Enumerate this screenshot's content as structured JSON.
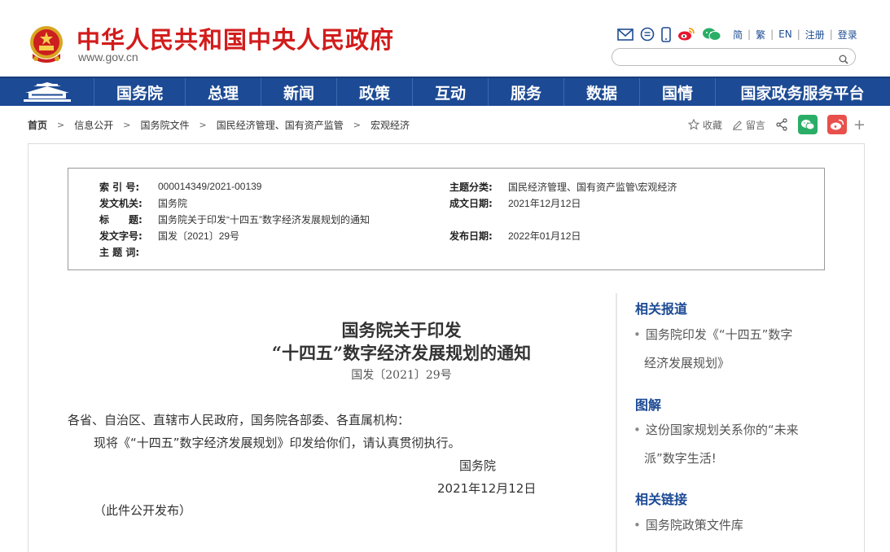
{
  "header": {
    "title": "中华人民共和国中央人民政府",
    "domain": "www.gov.cn",
    "icons": [
      "mail-icon",
      "message-icon",
      "mobile-icon",
      "weibo-icon",
      "wechat-icon"
    ],
    "links": [
      "简",
      "繁",
      "EN",
      "注册",
      "登录"
    ],
    "search_placeholder": ""
  },
  "nav": {
    "items": [
      "国务院",
      "总理",
      "新闻",
      "政策",
      "互动",
      "服务",
      "数据",
      "国情",
      "国家政务服务平台"
    ]
  },
  "breadcrumb": [
    "首页",
    "信息公开",
    "国务院文件",
    "国民经济管理、国有资产监管",
    "宏观经济"
  ],
  "tools": {
    "favorite": "收藏",
    "comment": "留言"
  },
  "meta": {
    "index_label": "索 引 号:",
    "index_value": "000014349/2021-00139",
    "subject_label": "主题分类:",
    "subject_value": "国民经济管理、国有资产监管\\宏观经济",
    "issuer_label": "发文机关:",
    "issuer_value": "国务院",
    "created_label": "成文日期:",
    "created_value": "2021年12月12日",
    "title_label": "标　　题:",
    "title_value": "国务院关于印发“十四五”数字经济发展规划的通知",
    "doc_no_label": "发文字号:",
    "doc_no_value": "国发〔2021〕29号",
    "published_label": "发布日期:",
    "published_value": "2022年01月12日",
    "keywords_label": "主 题 词:",
    "keywords_value": ""
  },
  "document": {
    "title_line1": "国务院关于印发",
    "title_line2": "“十四五”数字经济发展规划的通知",
    "doc_number": "国发〔2021〕29号",
    "salutation": "各省、自治区、直辖市人民政府，国务院各部委、各直属机构：",
    "body": "现将《“十四五”数字经济发展规划》印发给你们，请认真贯彻执行。",
    "signature": "国务院",
    "date": "2021年12月12日",
    "note": "（此件公开发布）"
  },
  "sidebar": {
    "related_reports_title": "相关报道",
    "related_reports": [
      "国务院印发《“十四五”数字经济发展规划》"
    ],
    "report_line1": "国务院印发《“十四五”数字",
    "report_line2": "经济发展规划》",
    "illustration_title": "图解",
    "illustration_line1": "这份国家规划关系你的“未来",
    "illustration_line2": "派”数字生活!",
    "links_title": "相关链接",
    "link1": "国务院政策文件库"
  },
  "colors": {
    "brand_red": "#d21c1c",
    "nav_blue": "#1c4a94",
    "link_blue": "#1f4c92"
  }
}
